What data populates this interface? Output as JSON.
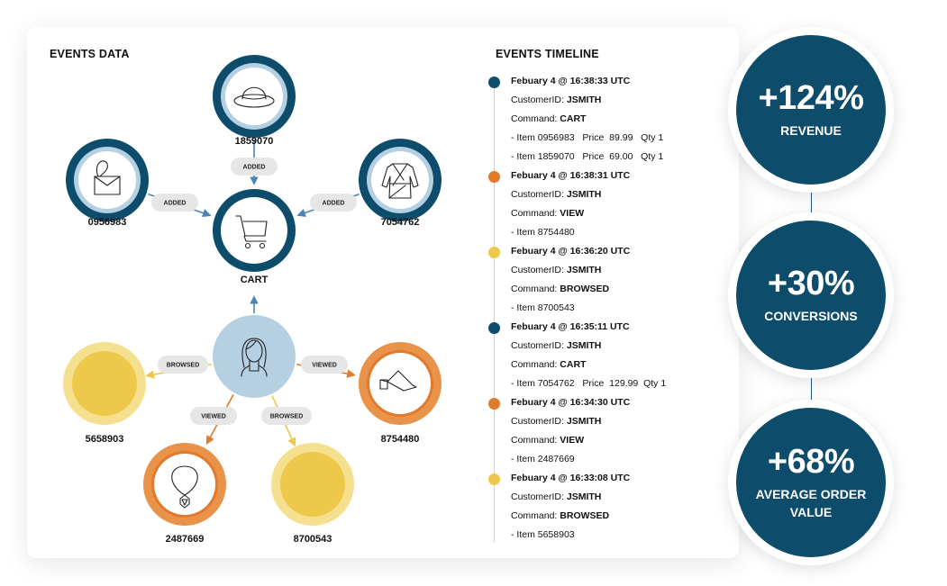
{
  "events_data": {
    "title": "EVENTS DATA",
    "nodes": [
      {
        "id": "1859070",
        "label": "1859070",
        "type": "product-cart",
        "icon": "hat-icon"
      },
      {
        "id": "0956983",
        "label": "0956983",
        "type": "product-cart",
        "icon": "handbag-icon"
      },
      {
        "id": "7054762",
        "label": "7054762",
        "type": "product-cart",
        "icon": "robe-icon"
      },
      {
        "id": "cart",
        "label": "CART",
        "type": "cart",
        "icon": "cart-icon"
      },
      {
        "id": "customer",
        "label": "",
        "type": "customer",
        "icon": "woman-avatar-icon"
      },
      {
        "id": "5658903",
        "label": "5658903",
        "type": "product-browsed",
        "icon": ""
      },
      {
        "id": "8754480",
        "label": "8754480",
        "type": "product-viewed",
        "icon": "shoe-icon"
      },
      {
        "id": "2487669",
        "label": "2487669",
        "type": "product-viewed",
        "icon": "necklace-icon"
      },
      {
        "id": "8700543",
        "label": "8700543",
        "type": "product-browsed",
        "icon": ""
      }
    ],
    "edges": [
      {
        "from": "1859070",
        "to": "cart",
        "label": "ADDED"
      },
      {
        "from": "0956983",
        "to": "cart",
        "label": "ADDED"
      },
      {
        "from": "7054762",
        "to": "cart",
        "label": "ADDED"
      },
      {
        "from": "customer",
        "to": "cart",
        "label": ""
      },
      {
        "from": "customer",
        "to": "5658903",
        "label": "BROWSED"
      },
      {
        "from": "customer",
        "to": "8754480",
        "label": "VIEWED"
      },
      {
        "from": "customer",
        "to": "2487669",
        "label": "VIEWED"
      },
      {
        "from": "customer",
        "to": "8700543",
        "label": "BROWSED"
      }
    ]
  },
  "timeline": {
    "title": "EVENTS TIMELINE",
    "events": [
      {
        "time": "Febuary 4 @ 16:38:33 UTC",
        "customer_label": "CustomerID: ",
        "customer": "JSMITH",
        "command_label": "Command: ",
        "command": "CART",
        "color": "navy",
        "items": [
          "- Item 0956983   Price  89.99   Qty 1",
          "- Item 1859070   Price  69.00   Qty 1"
        ]
      },
      {
        "time": "Febuary 4 @ 16:38:31 UTC",
        "customer_label": "CustomerID: ",
        "customer": "JSMITH",
        "command_label": "Command: ",
        "command": "VIEW",
        "color": "orange",
        "items": [
          "- Item 8754480"
        ]
      },
      {
        "time": "Febuary 4 @ 16:36:20 UTC",
        "customer_label": "CustomerID: ",
        "customer": "JSMITH",
        "command_label": "Command: ",
        "command": "BROWSED",
        "color": "yellow",
        "items": [
          "- Item 8700543"
        ]
      },
      {
        "time": "Febuary 4 @ 16:35:11 UTC",
        "customer_label": "CustomerID: ",
        "customer": "JSMITH",
        "command_label": "Command: ",
        "command": "CART",
        "color": "navy",
        "items": [
          "- Item 7054762   Price  129.99  Qty 1"
        ]
      },
      {
        "time": "Febuary 4 @ 16:34:30 UTC",
        "customer_label": "CustomerID: ",
        "customer": "JSMITH",
        "command_label": "Command: ",
        "command": "VIEW",
        "color": "orange",
        "items": [
          "- Item 2487669"
        ]
      },
      {
        "time": "Febuary 4 @ 16:33:08 UTC",
        "customer_label": "CustomerID: ",
        "customer": "JSMITH",
        "command_label": "Command: ",
        "command": "BROWSED",
        "color": "yellow",
        "items": [
          "- Item 5658903"
        ]
      }
    ]
  },
  "stats": [
    {
      "value": "+124%",
      "label_lines": [
        "REVENUE"
      ]
    },
    {
      "value": "+30%",
      "label_lines": [
        "CONVERSIONS"
      ]
    },
    {
      "value": "+68%",
      "label_lines": [
        "AVERAGE ORDER",
        "VALUE"
      ]
    }
  ],
  "colors": {
    "navy": "#0e4c6b",
    "light_blue": "#b5d0e3",
    "arrow_blue": "#4a86b5",
    "orange": "#e07a2c",
    "orange_light": "#e8924a",
    "yellow": "#eec84a",
    "yellow_light": "#f5e08f",
    "pill": "#e6e6e6"
  }
}
